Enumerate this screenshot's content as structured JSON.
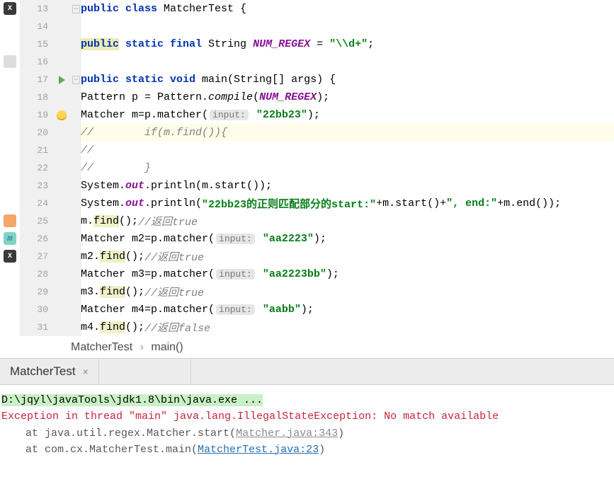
{
  "gutter": {
    "lines": [
      13,
      14,
      15,
      16,
      17,
      18,
      19,
      20,
      21,
      22,
      23,
      24,
      25,
      26,
      27,
      28,
      29,
      30,
      31
    ]
  },
  "code": {
    "l13": {
      "a": "public ",
      "b": "class ",
      "c": "MatcherTest {"
    },
    "l14": "",
    "l15": {
      "a": "public",
      "b": " static ",
      "c": "final ",
      "d": "String ",
      "e": "NUM_REGEX",
      "f": " = ",
      "g": "\"\\\\d+\"",
      "h": ";"
    },
    "l16": "",
    "l17": {
      "a": "public ",
      "b": "static ",
      "c": "void ",
      "d": "main(String[] args) {"
    },
    "l18": {
      "a": "Pattern p = Pattern.",
      "b": "compile",
      "c": "(",
      "d": "NUM_REGEX",
      "e": ");"
    },
    "l19": {
      "a": "Matcher m=p.matcher(",
      "hint": "input:",
      "b": " ",
      "c": "\"22bb23\"",
      "d": ");"
    },
    "l20": {
      "a": "//",
      "b": "        if(m.find()){"
    },
    "l21": "//",
    "l22": {
      "a": "//",
      "b": "        }"
    },
    "l23": {
      "a": "System.",
      "b": "out",
      "c": ".println(m.start());"
    },
    "l24": {
      "a": "System.",
      "b": "out",
      "c": ".println(",
      "d": "\"22bb23的正则匹配部分的start:\"",
      "e": "+m.start()+",
      "f": "\", end:\"",
      "g": "+m.end());"
    },
    "l25": {
      "a": "m.",
      "b": "find",
      "c": "();",
      "d": "//返回true"
    },
    "l26": {
      "a": "Matcher m2=p.matcher(",
      "hint": "input:",
      "b": " ",
      "c": "\"aa2223\"",
      "d": ");"
    },
    "l27": {
      "a": "m2.",
      "b": "find",
      "c": "();",
      "d": "//返回true"
    },
    "l28": {
      "a": "Matcher m3=p.matcher(",
      "hint": "input:",
      "b": " ",
      "c": "\"aa2223bb\"",
      "d": ");"
    },
    "l29": {
      "a": "m3.",
      "b": "find",
      "c": "();",
      "d": "//返回true"
    },
    "l30": {
      "a": "Matcher m4=p.matcher(",
      "hint": "input:",
      "b": " ",
      "c": "\"aabb\"",
      "d": ");"
    },
    "l31": {
      "a": "m4.",
      "b": "find",
      "c": "();",
      "d": "//返回false"
    }
  },
  "breadcrumb": {
    "cls": "MatcherTest",
    "sep": "›",
    "method": "main()"
  },
  "panel": {
    "tab": "MatcherTest",
    "close": "×"
  },
  "console": {
    "cmd": "D:\\jqyl\\javaTools\\jdk1.8\\bin\\java.exe ...",
    "exc": "Exception in thread \"main\" java.lang.IllegalStateException: No match available",
    "t1a": "at java.util.regex.Matcher.start(",
    "t1b": "Matcher.java:343",
    "t1c": ")",
    "t2a": "at com.cx.MatcherTest.main(",
    "t2b": "MatcherTest.java:23",
    "t2c": ")"
  }
}
